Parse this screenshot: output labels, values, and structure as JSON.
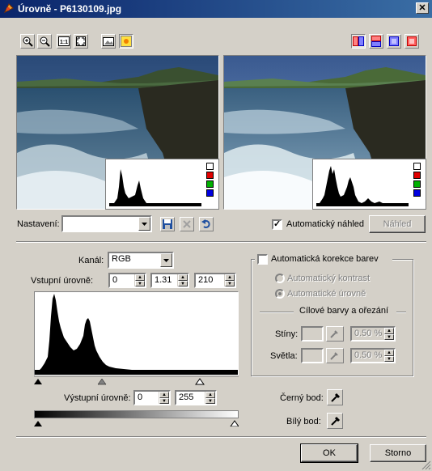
{
  "window": {
    "title": "Úrovně - P6130109.jpg",
    "close_glyph": "✕"
  },
  "toolbar_left": [
    "zoom-in-icon",
    "zoom-out-icon",
    "actual-size-icon",
    "fit-window-icon",
    "picture-icon",
    "sun-icon"
  ],
  "toolbar_right": [
    "split-vertical-icon",
    "split-horizontal-icon",
    "single-before-icon",
    "single-after-icon"
  ],
  "settings": {
    "label": "Nastavení:",
    "value": ""
  },
  "auto_preview": {
    "label": "Automatický náhled",
    "checked": true
  },
  "preview_button": "Náhled",
  "channel": {
    "label": "Kanál:",
    "value": "RGB"
  },
  "input_levels": {
    "label": "Vstupní úrovně:",
    "black": "0",
    "gamma": "1.31",
    "white": "210"
  },
  "output_levels": {
    "label": "Výstupní úrovně:",
    "black": "0",
    "white": "255"
  },
  "auto_correct": {
    "label": "Automatická korekce barev",
    "checked": false,
    "auto_contrast": "Automatický kontrast",
    "auto_levels": "Automatické úrovně",
    "target_group": "Cílové barvy a ořezání",
    "shadows": {
      "label": "Stíny:",
      "value": "0.50 %"
    },
    "highlights": {
      "label": "Světla:",
      "value": "0.50 %"
    }
  },
  "black_point": "Černý bod:",
  "white_point": "Bílý bod:",
  "buttons": {
    "ok": "OK",
    "cancel": "Storno"
  },
  "colors": {
    "title_start": "#0a246a",
    "title_end": "#3a6ea5",
    "face": "#d4d0c8"
  }
}
